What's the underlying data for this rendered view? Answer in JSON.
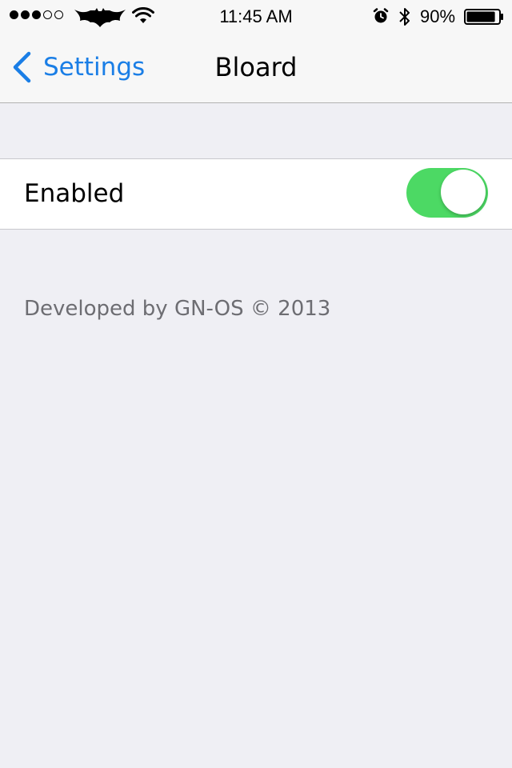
{
  "status_bar": {
    "signal_filled": 3,
    "signal_total": 5,
    "time": "11:45 AM",
    "battery_percent": "90%",
    "battery_level": 0.9,
    "icons": [
      "bat-logo-icon",
      "wifi-icon",
      "alarm-icon",
      "bluetooth-icon",
      "battery-icon"
    ]
  },
  "nav": {
    "back_label": "Settings",
    "title": "Bloard"
  },
  "settings": {
    "enabled_label": "Enabled",
    "enabled": true
  },
  "footer": {
    "text": "Developed by GN-OS © 2013"
  },
  "colors": {
    "accent": "#1a7ee6",
    "toggle_on": "#4cd964",
    "background": "#efeff4"
  }
}
